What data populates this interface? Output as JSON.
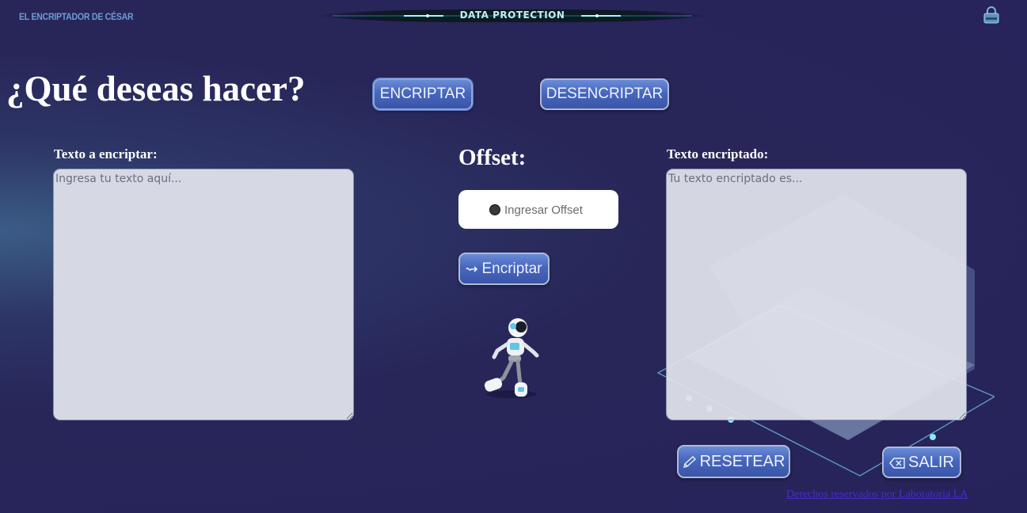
{
  "header": {
    "brand": "EL ENCRIPTADOR DE CÉSAR",
    "banner": "DATA PROTECTION"
  },
  "main": {
    "question": "¿Qué deseas hacer?",
    "mode_encrypt": "ENCRIPTAR",
    "mode_decrypt": "DESENCRIPTAR",
    "input_label": "Texto a encriptar:",
    "input_placeholder": "Ingresa tu texto aquí...",
    "offset_label": "Offset:",
    "offset_placeholder": "Ingresar Offset",
    "action_button": "Encriptar",
    "output_label": "Texto encriptado:",
    "output_placeholder": "Tu texto encriptado es...",
    "reset_button": "RESETEAR",
    "exit_button": "SALIR"
  },
  "footer": {
    "text": "Derechos reservados por Laboratoria LA"
  },
  "colors": {
    "background": "#26235a",
    "button": "#4767bd",
    "brand": "#6f9bd4",
    "link": "#4b2cc9"
  }
}
